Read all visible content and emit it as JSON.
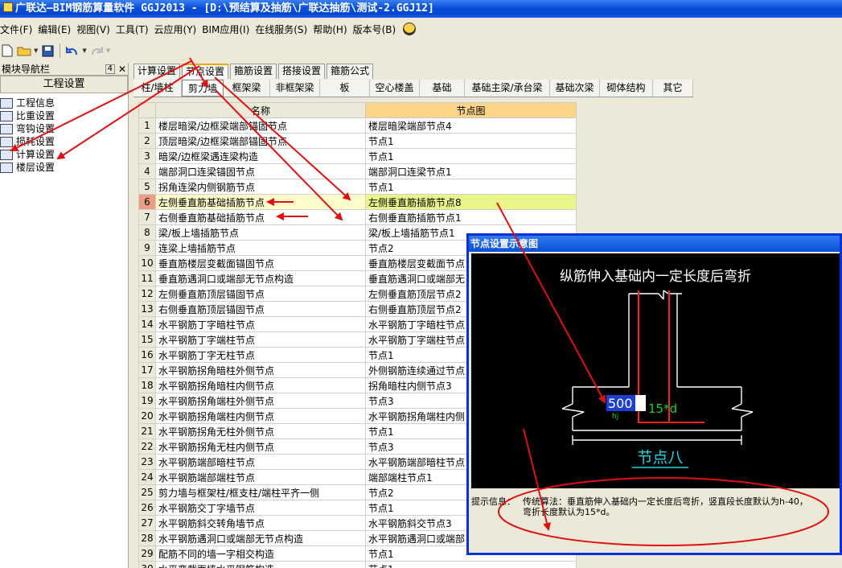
{
  "title": "广联达—BIM钢筋算量软件 GGJ2013 - [D:\\预结算及抽筋\\广联达抽筋\\测试-2.GGJ12]",
  "menu": [
    "文件(F)",
    "编辑(E)",
    "视图(V)",
    "工具(T)",
    "云应用(Y)",
    "BIM应用(I)",
    "在线服务(S)",
    "帮助(H)",
    "版本号(B)"
  ],
  "nav": {
    "title": "模块导航栏",
    "pin": "4",
    "header": "工程设置",
    "items": [
      "工程信息",
      "比重设置",
      "弯钩设置",
      "损耗设置",
      "计算设置",
      "楼层设置"
    ]
  },
  "tabs1": [
    "计算设置",
    "节点设置",
    "箍筋设置",
    "搭接设置",
    "箍筋公式"
  ],
  "tabs2": [
    "柱/墙柱",
    "剪力墙",
    "框架梁",
    "非框架梁",
    "板",
    "空心楼盖",
    "基础",
    "基础主梁/承台梁",
    "基础次梁",
    "砌体结构",
    "其它"
  ],
  "grid": {
    "col_name": "名称",
    "col_node": "节点图",
    "selected_row": 6,
    "rows": [
      [
        "1",
        "楼层暗梁/边框梁端部锚固节点",
        "楼层暗梁端部节点4"
      ],
      [
        "2",
        "顶层暗梁/边框梁端部锚固节点",
        "节点1"
      ],
      [
        "3",
        "暗梁/边框梁遇连梁构造",
        "节点1"
      ],
      [
        "4",
        "端部洞口连梁锚固节点",
        "端部洞口连梁节点1"
      ],
      [
        "5",
        "拐角连梁内侧钢筋节点",
        "节点1"
      ],
      [
        "6",
        "左侧垂直筋基础插筋节点",
        "左侧垂直筋插筋节点8"
      ],
      [
        "7",
        "右侧垂直筋基础插筋节点",
        "右侧垂直筋插筋节点1"
      ],
      [
        "8",
        "梁/板上墙插筋节点",
        "梁/板上墙插筋节点1"
      ],
      [
        "9",
        "连梁上墙插筋节点",
        "节点2"
      ],
      [
        "10",
        "垂直筋楼层变截面锚固节点",
        "垂直筋楼层变截面节点"
      ],
      [
        "11",
        "垂直筋遇洞口或端部无节点构造",
        "垂直筋遇洞口或端部无"
      ],
      [
        "12",
        "左侧垂直筋顶层锚固节点",
        "左侧垂直筋顶层节点2"
      ],
      [
        "13",
        "右侧垂直筋顶层锚固节点",
        "右侧垂直筋顶层节点2"
      ],
      [
        "14",
        "水平钢筋丁字暗柱节点",
        "水平钢筋丁字暗柱节点"
      ],
      [
        "15",
        "水平钢筋丁字端柱节点",
        "水平钢筋丁字端柱节点"
      ],
      [
        "16",
        "水平钢筋丁字无柱节点",
        "节点1"
      ],
      [
        "17",
        "水平钢筋拐角暗柱外侧节点",
        "外侧钢筋连续通过节点"
      ],
      [
        "18",
        "水平钢筋拐角暗柱内侧节点",
        "拐角暗柱内侧节点3"
      ],
      [
        "19",
        "水平钢筋拐角端柱外侧节点",
        "节点3"
      ],
      [
        "20",
        "水平钢筋拐角端柱内侧节点",
        "水平钢筋拐角端柱内侧"
      ],
      [
        "21",
        "水平钢筋拐角无柱外侧节点",
        "节点1"
      ],
      [
        "22",
        "水平钢筋拐角无柱内侧节点",
        "节点3"
      ],
      [
        "23",
        "水平钢筋端部暗柱节点",
        "水平钢筋端部暗柱节点"
      ],
      [
        "24",
        "水平钢筋端部端柱节点",
        "端部端柱节点1"
      ],
      [
        "25",
        "剪力墙与框架柱/框支柱/端柱平齐一侧",
        "节点2"
      ],
      [
        "26",
        "水平钢筋交丁字墙节点",
        "节点1"
      ],
      [
        "27",
        "水平钢筋斜交转角墙节点",
        "水平钢筋斜交节点3"
      ],
      [
        "28",
        "水平钢筋遇洞口或端部无节点构造",
        "水平钢筋遇洞口或端部"
      ],
      [
        "29",
        "配筋不同的墙一字相交构造",
        "节点1"
      ],
      [
        "30",
        "水平变截面墙水平钢筋构造",
        "节点1"
      ]
    ]
  },
  "dialog": {
    "title": "节点设置示意图",
    "caption": "纵筋伸入基础内一定长度后弯折",
    "input_value": "500",
    "dim_text": "15*d",
    "dim_small": "hj",
    "node_label": "节点八",
    "info_label": "提示信息：",
    "info_line1": "传统算法：垂直筋伸入基础内一定长度后弯折，竖直段长度默认为h-40，",
    "info_line2": "弯折长度默认为15*d。"
  },
  "colors": {
    "annotation_red": "#e01010",
    "diagram_red": "#ff2020",
    "diagram_green": "#20d020",
    "diagram_cyan": "#22d3e6",
    "selected_row_bg": "#fffccb",
    "header_node_bg": "#fbd587"
  },
  "icons": [
    "app-icon",
    "new-file-icon",
    "open-folder-icon",
    "save-icon",
    "undo-icon",
    "redo-icon",
    "help-icon",
    "pin-icon"
  ]
}
